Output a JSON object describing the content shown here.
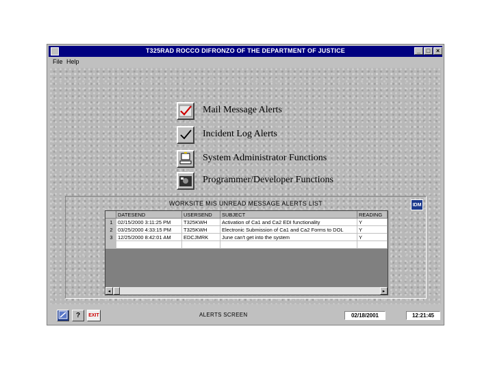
{
  "window": {
    "title": "T325RAD   ROCCO DIFRONZO OF THE DEPARTMENT OF JUSTICE",
    "minimize": "_",
    "maximize": "□",
    "close": "×"
  },
  "menu": {
    "file": "File",
    "help": "Help"
  },
  "functions": [
    {
      "label": "Mail Message Alerts",
      "icon": "mail-checkmark-icon"
    },
    {
      "label": "Incident Log Alerts",
      "icon": "checkmark-icon"
    },
    {
      "label": "System Administrator Functions",
      "icon": "computer-icon"
    },
    {
      "label": "Programmer/Developer Functions",
      "icon": "disk-drive-icon"
    }
  ],
  "alerts_panel": {
    "title": "WORKSITE MIS UNREAD MESSAGE ALERTS LIST",
    "button_label": "IDM",
    "columns": [
      "",
      "DATESEND",
      "USERSEND",
      "SUBJECT",
      "READING"
    ],
    "rows": [
      [
        "1",
        "02/15/2000 3:11:25 PM",
        "T325KWH",
        "Activation of Ca1 and Ca2 EDI functionality",
        "Y"
      ],
      [
        "2",
        "03/25/2000 4:33:15 PM",
        "T325KWH",
        "Electronic Submission of Ca1 and Ca2 Forms to DOL",
        "Y"
      ],
      [
        "3",
        "12/25/2000 8:42:01 AM",
        "EDCJMRK",
        "June can't get into the system",
        "Y"
      ]
    ]
  },
  "status": {
    "text": "ALERTS SCREEN",
    "date": "02/18/2001",
    "time": "12:21:45",
    "exit_label": "EXIT",
    "help_label": "?"
  },
  "colors": {
    "titlebar": "#000080",
    "face": "#c0c0c0",
    "checkmark": "#cc0000"
  }
}
